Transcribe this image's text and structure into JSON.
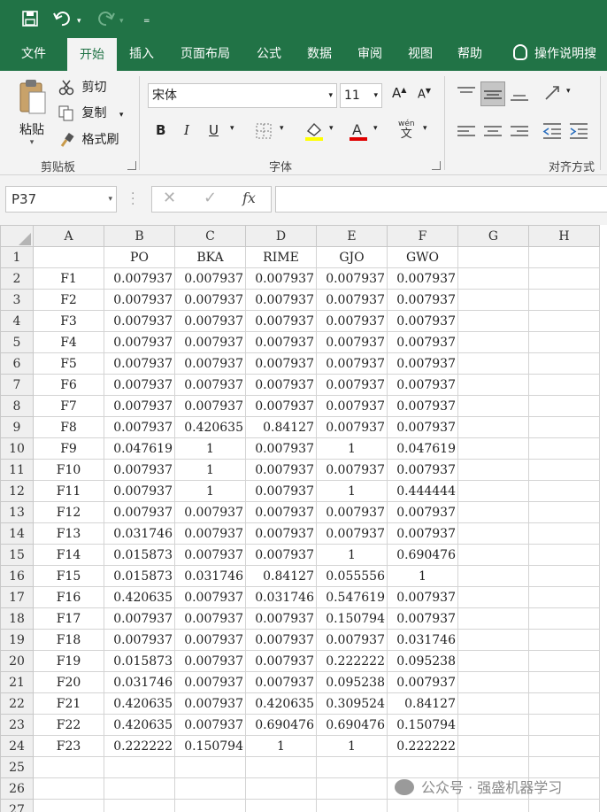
{
  "quick_access": {
    "undo_dropdown": "▾",
    "redo_dropdown": "▾",
    "customize": "="
  },
  "tabs": [
    {
      "label": "文件",
      "active": false
    },
    {
      "label": "开始",
      "active": true
    },
    {
      "label": "插入",
      "active": false
    },
    {
      "label": "页面布局",
      "active": false
    },
    {
      "label": "公式",
      "active": false
    },
    {
      "label": "数据",
      "active": false
    },
    {
      "label": "审阅",
      "active": false
    },
    {
      "label": "视图",
      "active": false
    },
    {
      "label": "帮助",
      "active": false
    }
  ],
  "tell_me": "操作说明搜",
  "ribbon": {
    "clipboard": {
      "paste": "粘贴",
      "cut": "剪切",
      "copy": "复制",
      "format_painter": "格式刷",
      "group": "剪贴板"
    },
    "font": {
      "name": "宋体",
      "size": "11",
      "group": "字体",
      "bold": "B",
      "italic": "I",
      "underline": "U",
      "phonetic": "wén"
    },
    "alignment": {
      "group": "对齐方式"
    }
  },
  "formula_bar": {
    "name_box": "P37",
    "formula": ""
  },
  "colors": {
    "brand": "#217346",
    "font_color_bar": "#e00000",
    "highlight_bar": "#ffff00"
  },
  "sheet": {
    "columns": [
      "A",
      "B",
      "C",
      "D",
      "E",
      "F",
      "G",
      "H"
    ],
    "header_row": [
      "",
      "PO",
      "BKA",
      "RIME",
      "GJO",
      "GWO"
    ],
    "rows": [
      [
        "F1",
        "0.007937",
        "0.007937",
        "0.007937",
        "0.007937",
        "0.007937"
      ],
      [
        "F2",
        "0.007937",
        "0.007937",
        "0.007937",
        "0.007937",
        "0.007937"
      ],
      [
        "F3",
        "0.007937",
        "0.007937",
        "0.007937",
        "0.007937",
        "0.007937"
      ],
      [
        "F4",
        "0.007937",
        "0.007937",
        "0.007937",
        "0.007937",
        "0.007937"
      ],
      [
        "F5",
        "0.007937",
        "0.007937",
        "0.007937",
        "0.007937",
        "0.007937"
      ],
      [
        "F6",
        "0.007937",
        "0.007937",
        "0.007937",
        "0.007937",
        "0.007937"
      ],
      [
        "F7",
        "0.007937",
        "0.007937",
        "0.007937",
        "0.007937",
        "0.007937"
      ],
      [
        "F8",
        "0.007937",
        "0.420635",
        "0.84127",
        "0.007937",
        "0.007937"
      ],
      [
        "F9",
        "0.047619",
        "1",
        "0.007937",
        "1",
        "0.047619"
      ],
      [
        "F10",
        "0.007937",
        "1",
        "0.007937",
        "0.007937",
        "0.007937"
      ],
      [
        "F11",
        "0.007937",
        "1",
        "0.007937",
        "1",
        "0.444444"
      ],
      [
        "F12",
        "0.007937",
        "0.007937",
        "0.007937",
        "0.007937",
        "0.007937"
      ],
      [
        "F13",
        "0.031746",
        "0.007937",
        "0.007937",
        "0.007937",
        "0.007937"
      ],
      [
        "F14",
        "0.015873",
        "0.007937",
        "0.007937",
        "1",
        "0.690476"
      ],
      [
        "F15",
        "0.015873",
        "0.031746",
        "0.84127",
        "0.055556",
        "1"
      ],
      [
        "F16",
        "0.420635",
        "0.007937",
        "0.031746",
        "0.547619",
        "0.007937"
      ],
      [
        "F17",
        "0.007937",
        "0.007937",
        "0.007937",
        "0.150794",
        "0.007937"
      ],
      [
        "F18",
        "0.007937",
        "0.007937",
        "0.007937",
        "0.007937",
        "0.031746"
      ],
      [
        "F19",
        "0.015873",
        "0.007937",
        "0.007937",
        "0.222222",
        "0.095238"
      ],
      [
        "F20",
        "0.031746",
        "0.007937",
        "0.007937",
        "0.095238",
        "0.007937"
      ],
      [
        "F21",
        "0.420635",
        "0.007937",
        "0.420635",
        "0.309524",
        "0.84127"
      ],
      [
        "F22",
        "0.420635",
        "0.007937",
        "0.690476",
        "0.690476",
        "0.150794"
      ],
      [
        "F23",
        "0.222222",
        "0.150794",
        "1",
        "1",
        "0.222222"
      ]
    ],
    "empty_rows": [
      "25",
      "26",
      "27"
    ]
  },
  "watermark": "公众号 · 强盛机器学习"
}
